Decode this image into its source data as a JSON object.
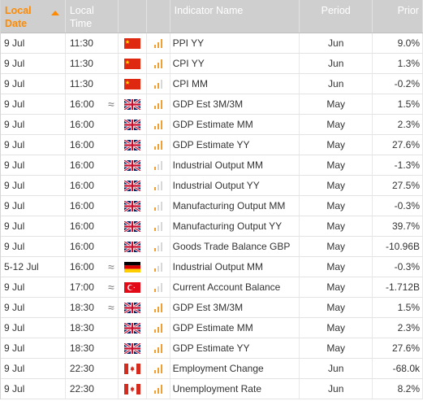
{
  "header": {
    "date_label_1": "Local",
    "date_label_2": "Date",
    "time_label_1": "Local",
    "time_label_2": "Time",
    "name_label": "Indicator Name",
    "period_label": "Period",
    "prior_label": "Prior"
  },
  "colors": {
    "accent": "#ff8a00",
    "impact_on": "#f0a030",
    "impact_off": "#d8d8d8",
    "header_bg": "#cfcfcf"
  },
  "rows": [
    {
      "date": "9 Jul",
      "time": "11:30",
      "tentative": "",
      "country": "CN",
      "impact": 3,
      "name": "PPI YY",
      "period": "Jun",
      "prior": "9.0%"
    },
    {
      "date": "9 Jul",
      "time": "11:30",
      "tentative": "",
      "country": "CN",
      "impact": 3,
      "name": "CPI YY",
      "period": "Jun",
      "prior": "1.3%"
    },
    {
      "date": "9 Jul",
      "time": "11:30",
      "tentative": "",
      "country": "CN",
      "impact": 2,
      "name": "CPI MM",
      "period": "Jun",
      "prior": "-0.2%"
    },
    {
      "date": "9 Jul",
      "time": "16:00",
      "tentative": "≈",
      "country": "GB",
      "impact": 3,
      "name": "GDP Est 3M/3M",
      "period": "May",
      "prior": "1.5%"
    },
    {
      "date": "9 Jul",
      "time": "16:00",
      "tentative": "",
      "country": "GB",
      "impact": 3,
      "name": "GDP Estimate MM",
      "period": "May",
      "prior": "2.3%"
    },
    {
      "date": "9 Jul",
      "time": "16:00",
      "tentative": "",
      "country": "GB",
      "impact": 3,
      "name": "GDP Estimate YY",
      "period": "May",
      "prior": "27.6%"
    },
    {
      "date": "9 Jul",
      "time": "16:00",
      "tentative": "",
      "country": "GB",
      "impact": 1,
      "name": "Industrial Output MM",
      "period": "May",
      "prior": "-1.3%"
    },
    {
      "date": "9 Jul",
      "time": "16:00",
      "tentative": "",
      "country": "GB",
      "impact": 1,
      "name": "Industrial Output YY",
      "period": "May",
      "prior": "27.5%"
    },
    {
      "date": "9 Jul",
      "time": "16:00",
      "tentative": "",
      "country": "GB",
      "impact": 1,
      "name": "Manufacturing Output MM",
      "period": "May",
      "prior": "-0.3%"
    },
    {
      "date": "9 Jul",
      "time": "16:00",
      "tentative": "",
      "country": "GB",
      "impact": 1,
      "name": "Manufacturing Output YY",
      "period": "May",
      "prior": "39.7%"
    },
    {
      "date": "9 Jul",
      "time": "16:00",
      "tentative": "",
      "country": "GB",
      "impact": 1,
      "name": "Goods Trade Balance GBP",
      "period": "May",
      "prior": "-10.96B"
    },
    {
      "date": "5-12 Jul",
      "time": "16:00",
      "tentative": "≈",
      "country": "DE",
      "impact": 1,
      "name": "Industrial Output MM",
      "period": "May",
      "prior": "-0.3%"
    },
    {
      "date": "9 Jul",
      "time": "17:00",
      "tentative": "≈",
      "country": "TR",
      "impact": 1,
      "name": "Current Account Balance",
      "period": "May",
      "prior": "-1.712B"
    },
    {
      "date": "9 Jul",
      "time": "18:30",
      "tentative": "≈",
      "country": "GB",
      "impact": 3,
      "name": "GDP Est 3M/3M",
      "period": "May",
      "prior": "1.5%"
    },
    {
      "date": "9 Jul",
      "time": "18:30",
      "tentative": "",
      "country": "GB",
      "impact": 3,
      "name": "GDP Estimate MM",
      "period": "May",
      "prior": "2.3%"
    },
    {
      "date": "9 Jul",
      "time": "18:30",
      "tentative": "",
      "country": "GB",
      "impact": 3,
      "name": "GDP Estimate YY",
      "period": "May",
      "prior": "27.6%"
    },
    {
      "date": "9 Jul",
      "time": "22:30",
      "tentative": "",
      "country": "CA",
      "impact": 3,
      "name": "Employment Change",
      "period": "Jun",
      "prior": "-68.0k"
    },
    {
      "date": "9 Jul",
      "time": "22:30",
      "tentative": "",
      "country": "CA",
      "impact": 3,
      "name": "Unemployment Rate",
      "period": "Jun",
      "prior": "8.2%"
    }
  ]
}
